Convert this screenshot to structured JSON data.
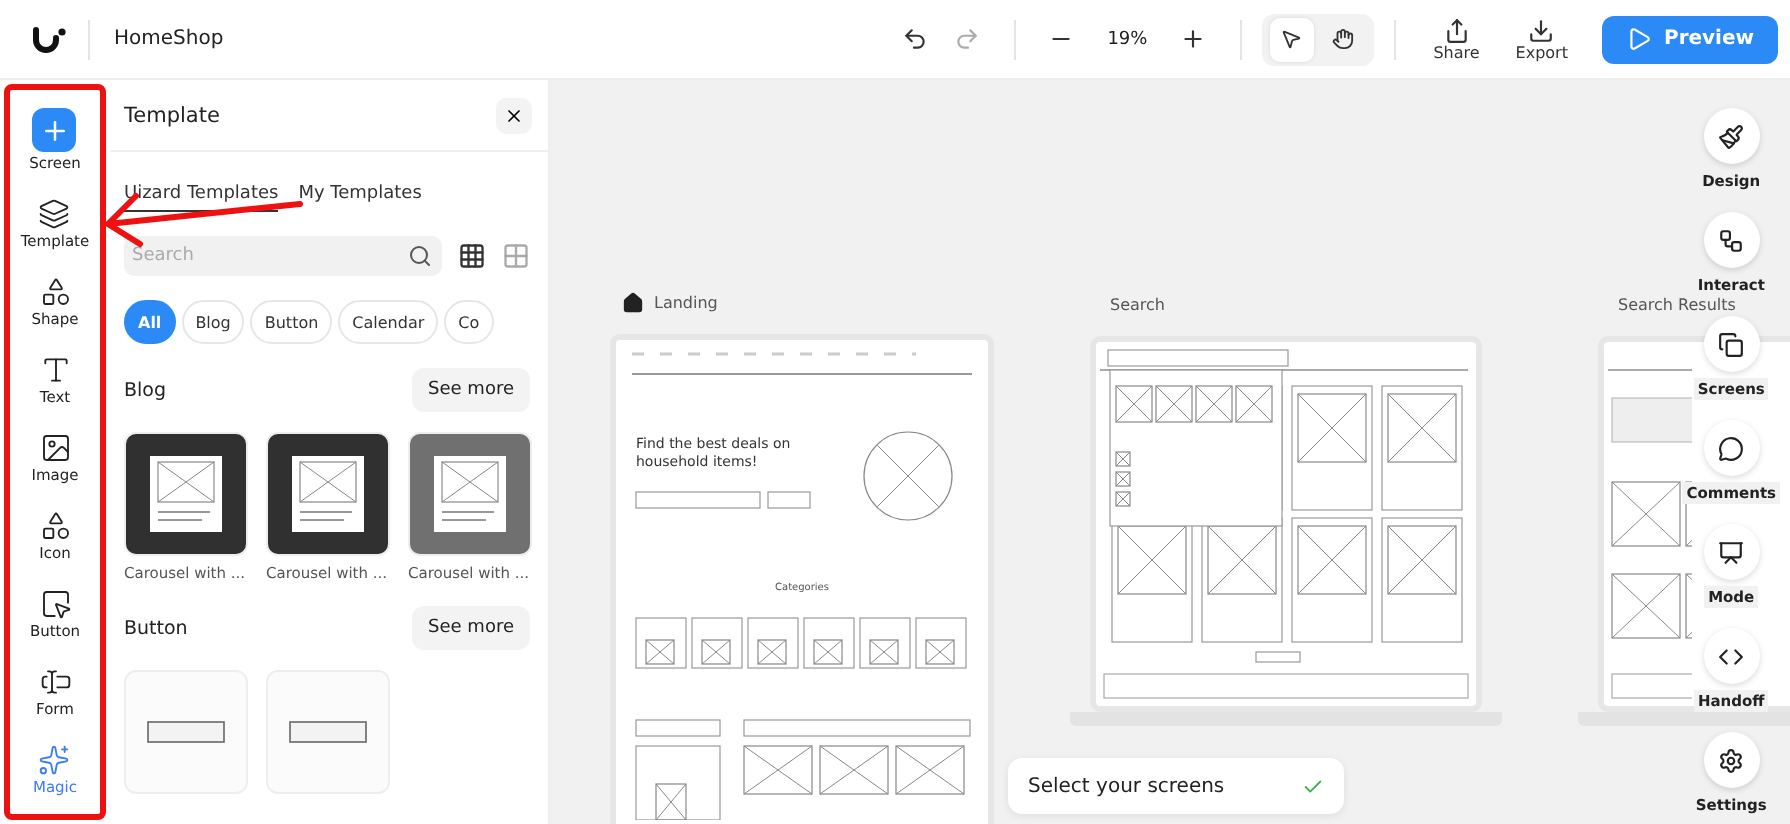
{
  "app": {
    "project": "HomeShop"
  },
  "toolbar": {
    "zoom": "19%",
    "tools": [
      {
        "kind": "pointer",
        "selected": true
      },
      {
        "kind": "hand",
        "selected": false
      }
    ],
    "actions": [
      {
        "kind": "share",
        "label": "Share"
      },
      {
        "kind": "export",
        "label": "Export"
      }
    ],
    "preview": "Preview"
  },
  "left_rail": [
    {
      "kind": "screen",
      "label": "Screen"
    },
    {
      "kind": "template",
      "label": "Template"
    },
    {
      "kind": "shape",
      "label": "Shape"
    },
    {
      "kind": "text",
      "label": "Text"
    },
    {
      "kind": "image",
      "label": "Image"
    },
    {
      "kind": "icon",
      "label": "Icon"
    },
    {
      "kind": "button",
      "label": "Button"
    },
    {
      "kind": "form",
      "label": "Form"
    },
    {
      "kind": "magic",
      "label": "Magic"
    }
  ],
  "panel": {
    "title": "Template",
    "tabs": [
      {
        "label": "Uizard Templates",
        "selected": true
      },
      {
        "label": "My Templates",
        "selected": false
      }
    ],
    "search": {
      "placeholder": "Search"
    },
    "views": [
      {
        "kind": "dense",
        "selected": true
      },
      {
        "kind": "large",
        "selected": false
      }
    ],
    "filters": [
      {
        "label": "All",
        "selected": true
      },
      {
        "label": "Blog",
        "selected": false
      },
      {
        "label": "Button",
        "selected": false
      },
      {
        "label": "Calendar",
        "selected": false
      },
      {
        "label": "Co",
        "selected": false
      }
    ],
    "sections": [
      {
        "title": "Blog",
        "see_more": "See more",
        "items": [
          {
            "kind": "carousel",
            "caption": "Carousel with ...",
            "color": "#303030"
          },
          {
            "kind": "carousel",
            "caption": "Carousel with ...",
            "color": "#303030"
          },
          {
            "kind": "carousel",
            "caption": "Carousel with ...",
            "color": "#707070"
          }
        ]
      },
      {
        "title": "Button",
        "see_more": "See more",
        "items": [
          {
            "kind": "button"
          },
          {
            "kind": "button"
          }
        ]
      }
    ]
  },
  "canvas": {
    "screens": [
      {
        "kind": "landing",
        "title": "Landing",
        "home": true,
        "headline": "Find the best deals on household items!",
        "section": "Categories"
      },
      {
        "kind": "search",
        "title": "Search",
        "home": false
      },
      {
        "kind": "results",
        "title": "Search Results",
        "home": false
      }
    ]
  },
  "toast": {
    "text": "Select your screens",
    "done": true
  },
  "right_rail": [
    {
      "kind": "design",
      "label": "Design"
    },
    {
      "kind": "interact",
      "label": "Interact"
    },
    {
      "kind": "screens",
      "label": "Screens"
    },
    {
      "kind": "comments",
      "label": "Comments"
    },
    {
      "kind": "mode",
      "label": "Mode"
    },
    {
      "kind": "handoff",
      "label": "Handoff"
    },
    {
      "kind": "settings",
      "label": "Settings"
    }
  ]
}
